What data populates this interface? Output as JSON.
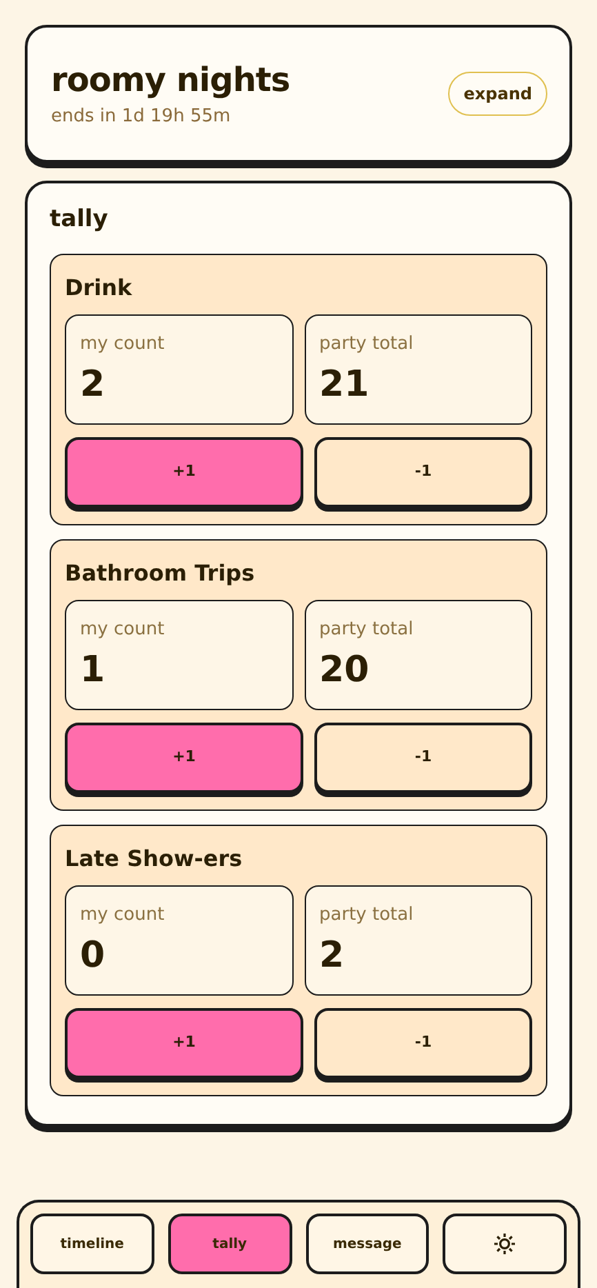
{
  "header": {
    "title": "roomy nights",
    "subtitle": "ends in 1d 19h 55m",
    "button": "expand"
  },
  "tally": {
    "title": "tally",
    "categories": [
      {
        "name": "Drink",
        "my_label": "my count",
        "my_count": "2",
        "total_label": "party total",
        "total": "21",
        "plus": "+1",
        "minus": "-1"
      },
      {
        "name": "Bathroom Trips",
        "my_label": "my count",
        "my_count": "1",
        "total_label": "party total",
        "total": "20",
        "plus": "+1",
        "minus": "-1"
      },
      {
        "name": "Late Show-ers",
        "my_label": "my count",
        "my_count": "0",
        "total_label": "party total",
        "total": "2",
        "plus": "+1",
        "minus": "-1"
      }
    ]
  },
  "nav": [
    {
      "kind": "text",
      "label": "timeline",
      "selected": false
    },
    {
      "kind": "text",
      "label": "tally",
      "selected": true
    },
    {
      "kind": "text",
      "label": "message",
      "selected": false
    },
    {
      "kind": "icon",
      "selected": false
    }
  ]
}
